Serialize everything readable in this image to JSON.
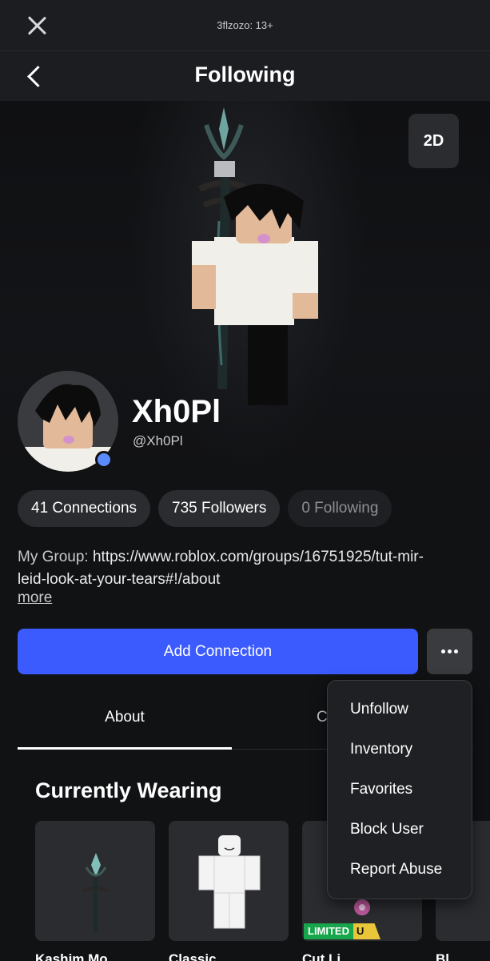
{
  "topbar": {
    "title": "3flzozo: 13+"
  },
  "navbar": {
    "title": "Following"
  },
  "hero": {
    "view_toggle_label": "2D"
  },
  "profile": {
    "display_name": "Xh0Pl",
    "username": "@Xh0Pl",
    "online_color": "#5b8cff"
  },
  "stats": [
    {
      "label": "41 Connections"
    },
    {
      "label": "735 Followers"
    },
    {
      "label": "0 Following"
    }
  ],
  "bio": {
    "label": "My Group:",
    "text": "https://www.roblox.com/groups/16751925/tut-mir-leid-look-at-your-tears#!/about",
    "line1": "https://www.roblox.com/groups/16751925/tut-mir-",
    "line2": "leid-look-at-your-tears#!/about",
    "more_label": "more"
  },
  "actions": {
    "add_connection_label": "Add Connection",
    "accent_color": "#3b5bff"
  },
  "tabs": [
    {
      "label": "About",
      "active": true
    },
    {
      "label": "C",
      "active": false
    }
  ],
  "wearing": {
    "title": "Currently Wearing",
    "items": [
      {
        "name": "Kashim Mo",
        "image": "staff-icon"
      },
      {
        "name": "Classic",
        "image": "body-icon"
      },
      {
        "name": "Cut Li",
        "image": "accessory-icon",
        "badge_limited": "LIMITED",
        "badge_u": "U"
      },
      {
        "name": "Bl",
        "image": "item-icon"
      }
    ]
  },
  "menu": {
    "items": [
      {
        "label": "Unfollow"
      },
      {
        "label": "Inventory"
      },
      {
        "label": "Favorites"
      },
      {
        "label": "Block User"
      },
      {
        "label": "Report Abuse"
      }
    ]
  }
}
